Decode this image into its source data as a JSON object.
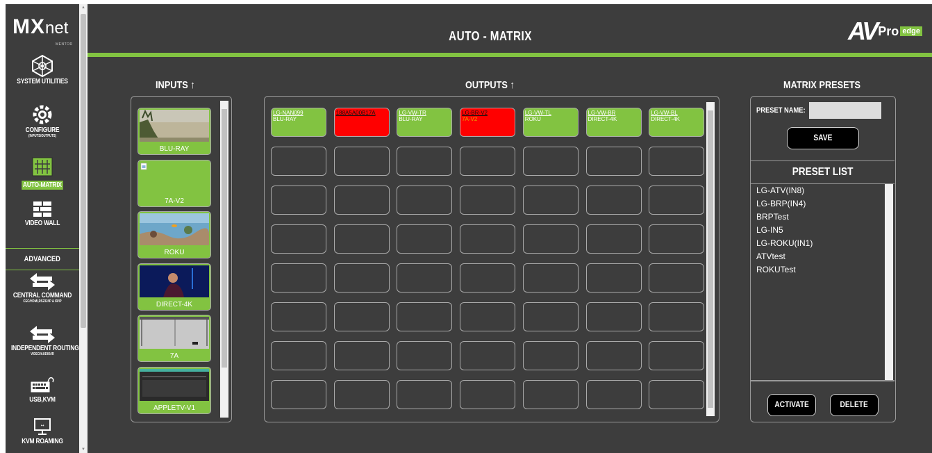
{
  "sidebar": {
    "logo_main": "MX",
    "logo_net": "net",
    "logo_mentor": "MENTOR",
    "items": [
      {
        "label": "SYSTEM UTILITIES",
        "sub": ""
      },
      {
        "label": "CONFIGURE",
        "sub": "(INPUTS/OUTPUTS)"
      },
      {
        "label": "AUTO-MATRIX",
        "sub": ""
      },
      {
        "label": "VIDEO WALL",
        "sub": ""
      },
      {
        "label": "CENTRAL COMMAND",
        "sub": "CEC/HDMI,RS232/IP & IR/IP"
      },
      {
        "label": "INDEPENDENT ROUTING",
        "sub": "VIDEO/AUDIO/IR"
      },
      {
        "label": "USB,KVM",
        "sub": ""
      },
      {
        "label": "KVM ROAMING",
        "sub": ""
      }
    ],
    "advanced_label": "ADVANCED"
  },
  "header": {
    "title": "AUTO - MATRIX",
    "brand_av": "AV",
    "brand_pro": "Pro",
    "brand_edge": "edge"
  },
  "inputs": {
    "heading": "INPUTS ↑",
    "items": [
      {
        "name": "BLU-RAY",
        "thumb": "field"
      },
      {
        "name": "7A-V2",
        "thumb": "broken"
      },
      {
        "name": "ROKU",
        "thumb": "aquarium"
      },
      {
        "name": "DIRECT-4K",
        "thumb": "concert"
      },
      {
        "name": "7A",
        "thumb": "gray"
      },
      {
        "name": "APPLETV-V1",
        "thumb": "appletv"
      }
    ]
  },
  "outputs": {
    "heading": "OUTPUTS ↑",
    "row1": [
      {
        "name": "LG-NAN099",
        "source": "BLU-RAY",
        "status": "green"
      },
      {
        "name": "188A5A00B17A",
        "source": "",
        "status": "red"
      },
      {
        "name": "LG-VW-TR",
        "source": "BLU-RAY",
        "status": "green"
      },
      {
        "name": "LG-BR-V2",
        "source": "7A-V2",
        "status": "red"
      },
      {
        "name": "LG-VW-TL",
        "source": "ROKU",
        "status": "green"
      },
      {
        "name": "LG-VW-BR",
        "source": "DIRECT-4K",
        "status": "green"
      },
      {
        "name": "LG-VW-BL",
        "source": "DIRECT-4K",
        "status": "green"
      }
    ]
  },
  "presets": {
    "heading": "MATRIX PRESETS",
    "name_label": "PRESET NAME:",
    "name_value": "",
    "save_label": "SAVE",
    "list_heading": "PRESET LIST",
    "list": [
      "LG-ATV(IN8)",
      "LG-BRP(IN4)",
      "BRPTest",
      "LG-IN5",
      "LG-ROKU(IN1)",
      "ATVtest",
      "ROKUTest"
    ],
    "activate_label": "ACTIVATE",
    "delete_label": "DELETE"
  },
  "colors": {
    "accent": "#82c341",
    "panel": "#3d3d3d",
    "error": "#ff0000"
  }
}
